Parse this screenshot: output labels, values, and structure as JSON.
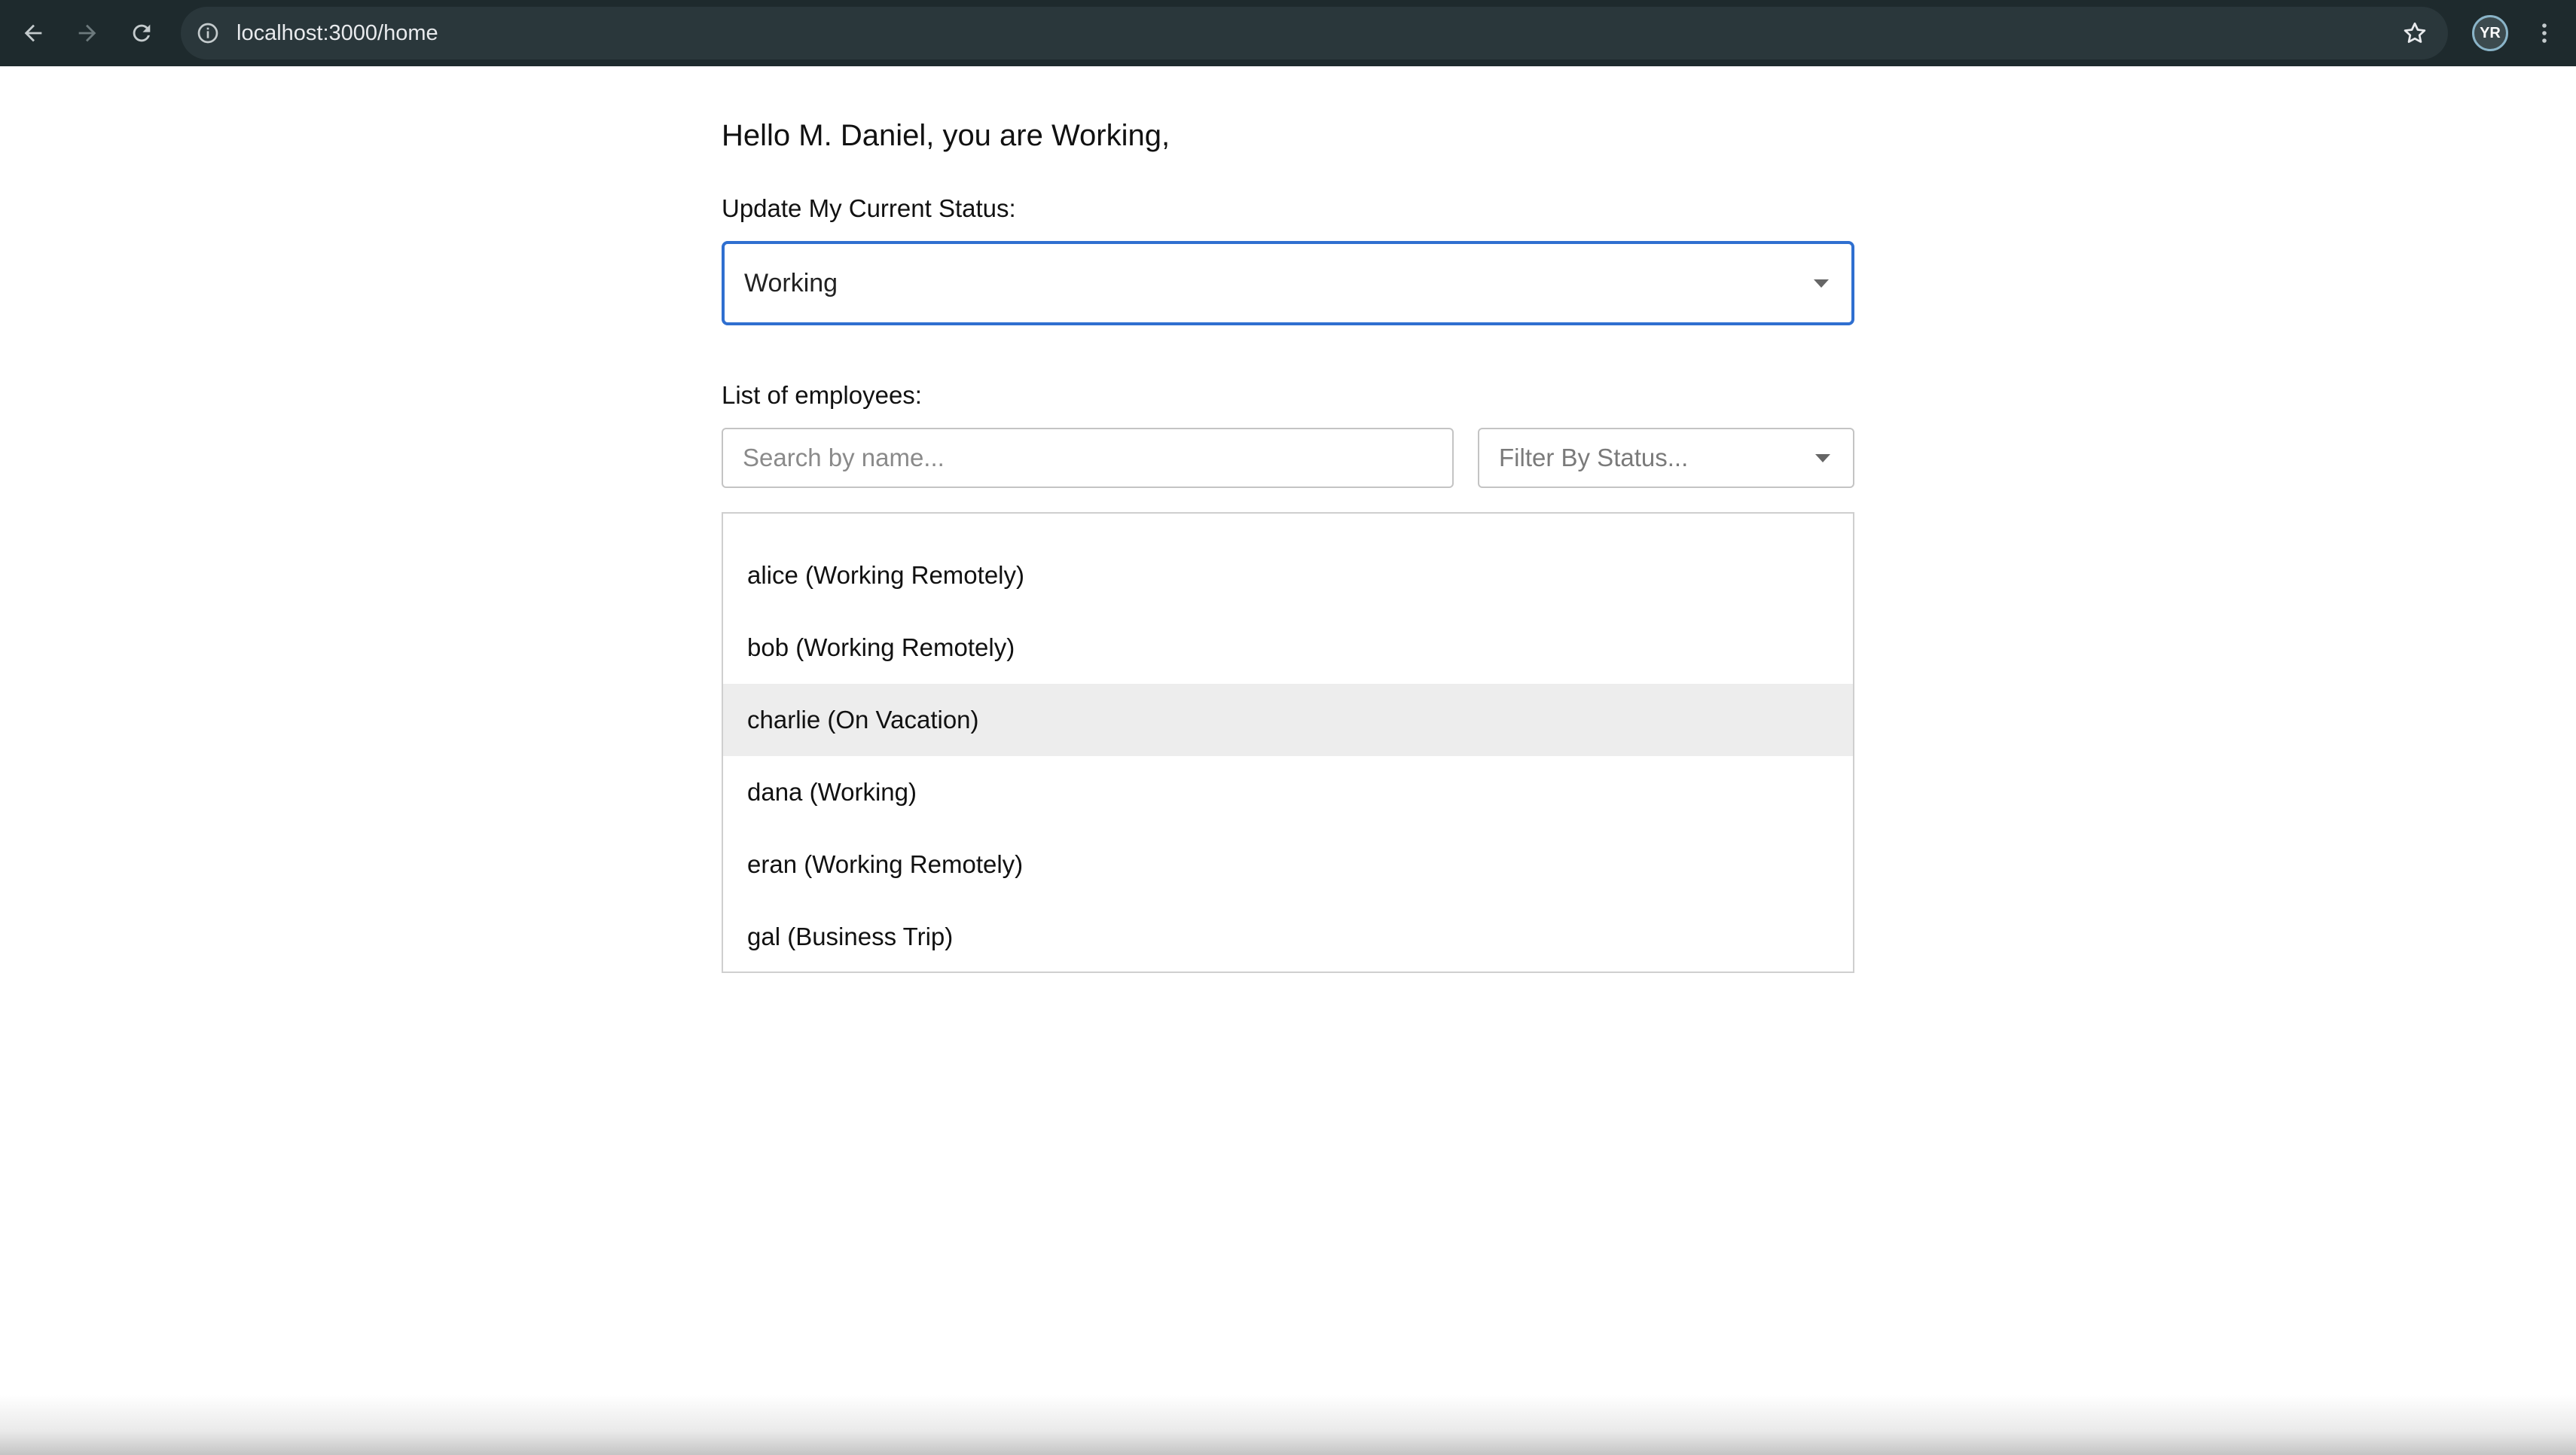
{
  "browser": {
    "url": "localhost:3000/home",
    "profile_initials": "YR"
  },
  "page": {
    "greeting": "Hello M. Daniel, you are Working,",
    "status_label": "Update My Current Status:",
    "status_selected": "Working",
    "employees_label": "List of employees:",
    "search_placeholder": "Search by name...",
    "filter_placeholder": "Filter By Status..."
  },
  "employees": [
    {
      "label": "alice (Working Remotely)"
    },
    {
      "label": "bob (Working Remotely)"
    },
    {
      "label": "charlie (On Vacation)",
      "highlighted": true
    },
    {
      "label": "dana (Working)"
    },
    {
      "label": "eran (Working Remotely)"
    },
    {
      "label": "gal (Business Trip)"
    }
  ],
  "colors": {
    "browser_bar": "#1e2a2d",
    "focus_border": "#2f6fd0",
    "row_highlight": "#ededed"
  },
  "icons": [
    "back-arrow-icon",
    "forward-arrow-icon",
    "reload-icon",
    "info-icon",
    "star-icon",
    "kebab-menu-icon",
    "chevron-down-icon"
  ]
}
